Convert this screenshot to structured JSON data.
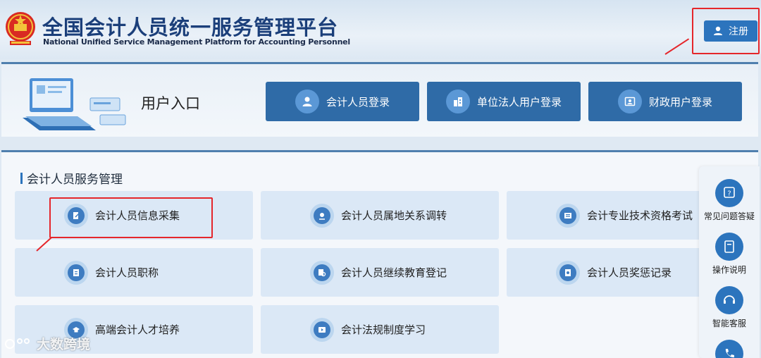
{
  "header": {
    "title": "全国会计人员统一服务管理平台",
    "subtitle": "National Unified Service Management Platform for Accounting Personnel",
    "register_label": "注册"
  },
  "entry": {
    "title": "用户入口",
    "buttons": [
      {
        "label": "会计人员登录",
        "icon": "user-icon"
      },
      {
        "label": "单位法人用户登录",
        "icon": "building-icon"
      },
      {
        "label": "财政用户登录",
        "icon": "id-card-icon"
      }
    ]
  },
  "services": {
    "title": "会计人员服务管理",
    "cards": [
      {
        "label": "会计人员信息采集",
        "icon": "edit-doc-icon"
      },
      {
        "label": "会计人员属地关系调转",
        "icon": "location-icon"
      },
      {
        "label": "会计专业技术资格考试",
        "icon": "exam-icon"
      },
      {
        "label": "会计人员职称",
        "icon": "doc-icon"
      },
      {
        "label": "会计人员继续教育登记",
        "icon": "doc-search-icon"
      },
      {
        "label": "会计人员奖惩记录",
        "icon": "record-icon"
      },
      {
        "label": "高端会计人才培养",
        "icon": "graduation-cap-icon"
      },
      {
        "label": "会计法规制度学习",
        "icon": "play-icon"
      }
    ]
  },
  "sidebar": {
    "items": [
      {
        "label": "常见问题答疑",
        "icon": "question-icon"
      },
      {
        "label": "操作说明",
        "icon": "manual-icon"
      },
      {
        "label": "智能客服",
        "icon": "headset-icon"
      },
      {
        "label": "",
        "icon": "phone-icon"
      }
    ]
  },
  "watermark": "大数跨境",
  "colors": {
    "primary": "#2f6ba7",
    "accent": "#2c74bd",
    "highlight": "#e5262b",
    "card": "#dbe8f6"
  }
}
